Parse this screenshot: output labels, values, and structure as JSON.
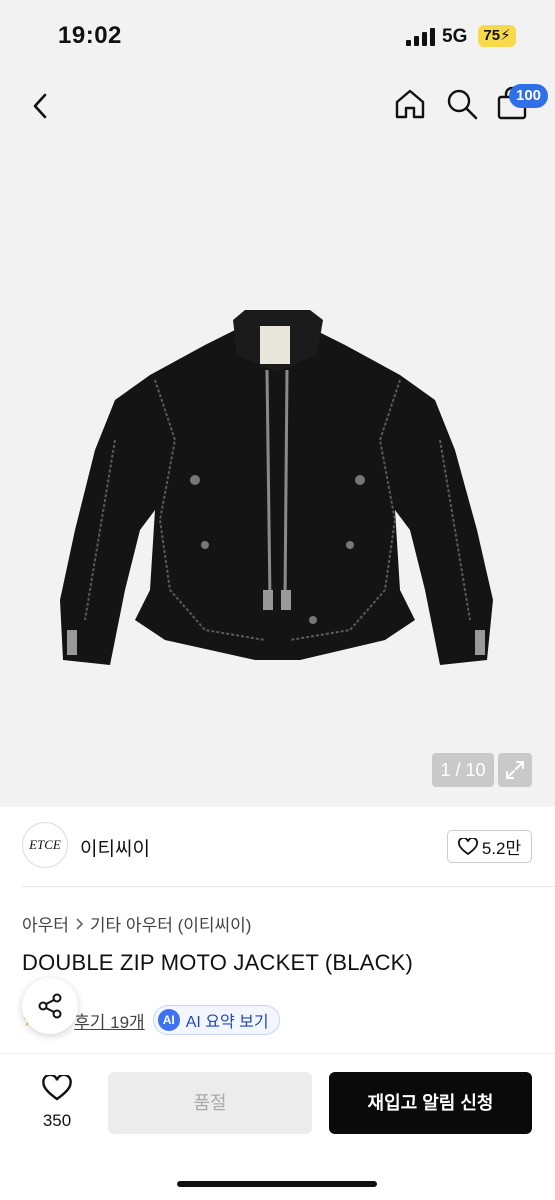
{
  "status": {
    "time": "19:02",
    "network": "5G",
    "battery": "75"
  },
  "nav": {
    "back_icon": "chevron-left-icon",
    "home_icon": "home-icon",
    "search_icon": "search-icon",
    "cart_icon": "shopping-bag-icon",
    "cart_badge": "100"
  },
  "gallery": {
    "pager": "1 / 10",
    "expand_icon": "expand-icon"
  },
  "brand": {
    "logo_text": "ETCE",
    "name": "이티씨이",
    "likes": "5.2만"
  },
  "breadcrumb": {
    "level1": "아우터",
    "level2": "기타 아우터 (이티씨이)"
  },
  "product": {
    "title": "DOUBLE ZIP MOTO JACKET (BLACK)"
  },
  "reviews": {
    "review_link": "후기 19개",
    "ai_label": "AI 요약 보기",
    "ai_icon_text": "AI"
  },
  "bottom": {
    "wishlist_count": "350",
    "soldout_label": "품절",
    "restock_label": "재입고 알림 신청"
  },
  "colors": {
    "accent_blue": "#2f6fe8",
    "battery": "#f7d94c",
    "primary_button": "#0a0a0a"
  }
}
